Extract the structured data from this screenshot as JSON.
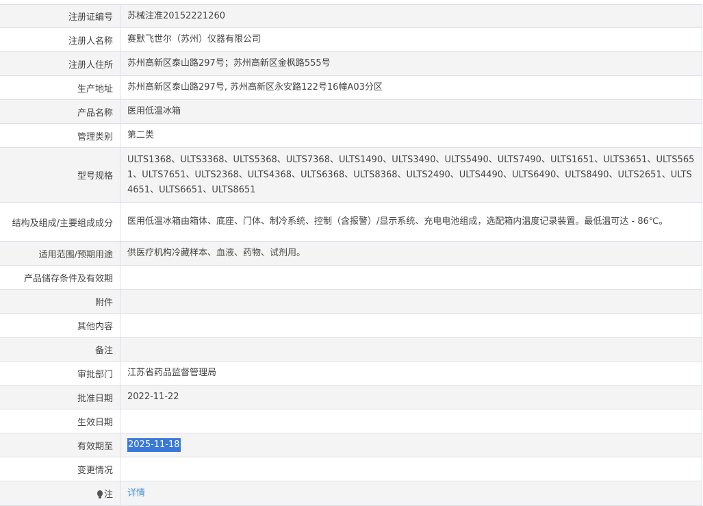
{
  "rows": [
    {
      "label": "注册证编号",
      "value": "苏械注准20152221260"
    },
    {
      "label": "注册人名称",
      "value": "赛默飞世尔（苏州）仪器有限公司"
    },
    {
      "label": "注册人住所",
      "value": "苏州高新区泰山路297号；苏州高新区金枫路555号"
    },
    {
      "label": "生产地址",
      "value": "苏州高新区泰山路297号, 苏州高新区永安路122号16幢A03分区"
    },
    {
      "label": "产品名称",
      "value": "医用低温冰箱"
    },
    {
      "label": "管理类别",
      "value": "第二类"
    },
    {
      "label": "型号规格",
      "value": "ULTS1368、ULTS3368、ULTS5368、ULTS7368、ULTS1490、ULTS3490、ULTS5490、ULTS7490、ULTS1651、ULTS3651、ULTS5651、ULTS7651、ULTS2368、ULTS4368、ULTS6368、ULTS8368、ULTS2490、ULTS4490、ULTS6490、ULTS8490、ULTS2651、ULTS4651、ULTS6651、ULTS8651"
    },
    {
      "label": "结构及组成/主要组成成分",
      "value": "医用低温冰箱由箱体、底座、门体、制冷系统、控制（含报警）/显示系统、充电电池组成，选配箱内温度记录装置。最低温可达 - 86℃。"
    },
    {
      "label": "适用范围/预期用途",
      "value": "供医疗机构冷藏样本、血液、药物、试剂用。"
    },
    {
      "label": "产品储存条件及有效期",
      "value": ""
    },
    {
      "label": "附件",
      "value": ""
    },
    {
      "label": "其他内容",
      "value": ""
    },
    {
      "label": "备注",
      "value": ""
    },
    {
      "label": "审批部门",
      "value": "江苏省药品监督管理局"
    },
    {
      "label": "批准日期",
      "value": "2022-11-22"
    },
    {
      "label": "生效日期",
      "value": ""
    },
    {
      "label": "有效期至",
      "value": "2025-11-18"
    },
    {
      "label": "变更情况",
      "value": ""
    },
    {
      "label": "注",
      "value": "详情"
    }
  ],
  "icons": {
    "note_icon": "lightbulb-icon"
  },
  "colors": {
    "border": "#dcdfe6",
    "alt_row": "#f4f4f5",
    "selection": "#3a78d8",
    "link": "#3d8fd8"
  }
}
